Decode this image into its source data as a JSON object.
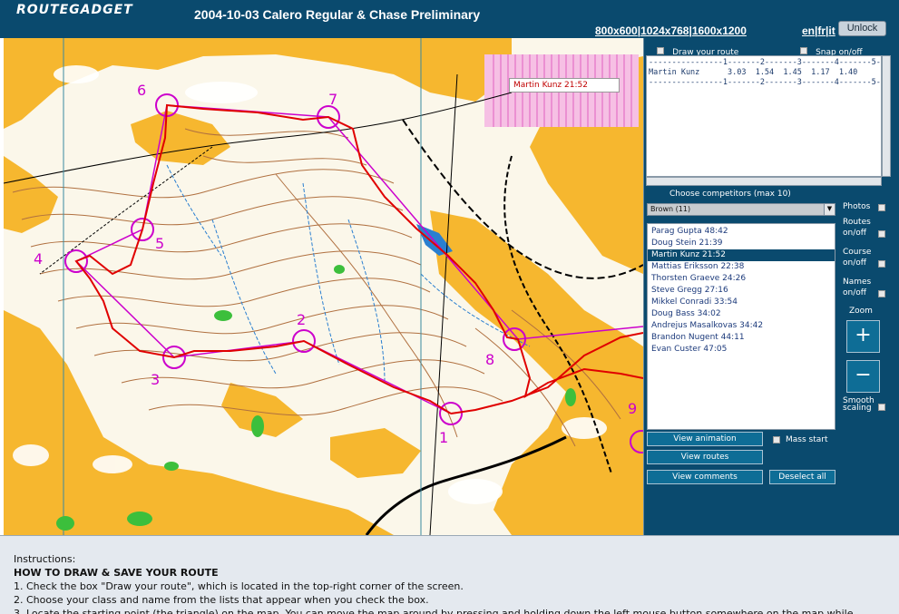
{
  "header": {
    "logo": "ROUTEGADGET",
    "event_title": "2004-10-03 Calero Regular & Chase Preliminary",
    "res_800": "800x600",
    "res_1024": "1024x768",
    "res_1600": "1600x1200",
    "sep": "|",
    "lang_en": "en",
    "lang_fr": "fr",
    "lang_it": "it",
    "unlock": "Unlock"
  },
  "map": {
    "hover_label": "Martin Kunz  21:52",
    "controls": [
      "1",
      "2",
      "3",
      "4",
      "5",
      "6",
      "7",
      "8",
      "9"
    ],
    "colors": {
      "forest": "#f6b72f",
      "open": "#fbf7ea",
      "route": "#e00000",
      "course": "#cc00cc",
      "contour": "#b07040",
      "water": "#2a7fd0"
    }
  },
  "panel": {
    "draw_route": "Draw your route",
    "snap": "Snap on/off",
    "splits_lines": [
      "----------------1-------2-------3-------4-------5----",
      "Martin Kunz      3.03  1.54  1.45  1.17  1.40",
      "----------------1-------2-------3-------4-------5----"
    ],
    "choose_label": "Choose competitors (max 10)",
    "class_value": "Brown (11)",
    "competitors": [
      "Parag Gupta  48:42",
      "Doug Stein  21:39",
      "Martin Kunz  21:52",
      "Mattias Eriksson  22:38",
      "Thorsten Graeve  24:26",
      "Steve Gregg  27:16",
      "Mikkel Conradi  33:54",
      "Doug Bass  34:02",
      "Andrejus Masalkovas  34:42",
      "Brandon Nugent  44:11",
      "Evan Custer  47:05"
    ],
    "selected_index": 2,
    "photos": "Photos",
    "routes_1": "Routes",
    "routes_2": "on/off",
    "course_1": "Course",
    "course_2": "on/off",
    "names_1": "Names",
    "names_2": "on/off",
    "zoom": "Zoom",
    "zoom_in": "+",
    "zoom_out": "−",
    "smooth_1": "Smooth",
    "smooth_2": "scaling",
    "view_animation": "View animation",
    "mass_start": "Mass start",
    "view_routes": "View routes",
    "view_comments": "View comments",
    "deselect_all": "Deselect all"
  },
  "instructions": {
    "intro": "Instructions:",
    "heading": "HOW TO DRAW & SAVE YOUR ROUTE",
    "step1": "1. Check the box \"Draw your route\", which is located in the top-right corner of the screen.",
    "step2": "2. Choose your class and name from the lists that appear when you check the box.",
    "step3": "3. Locate the starting point (the triangle) on the map. You can move the map around by pressing and holding down the left mouse button somewhere on the map while"
  }
}
